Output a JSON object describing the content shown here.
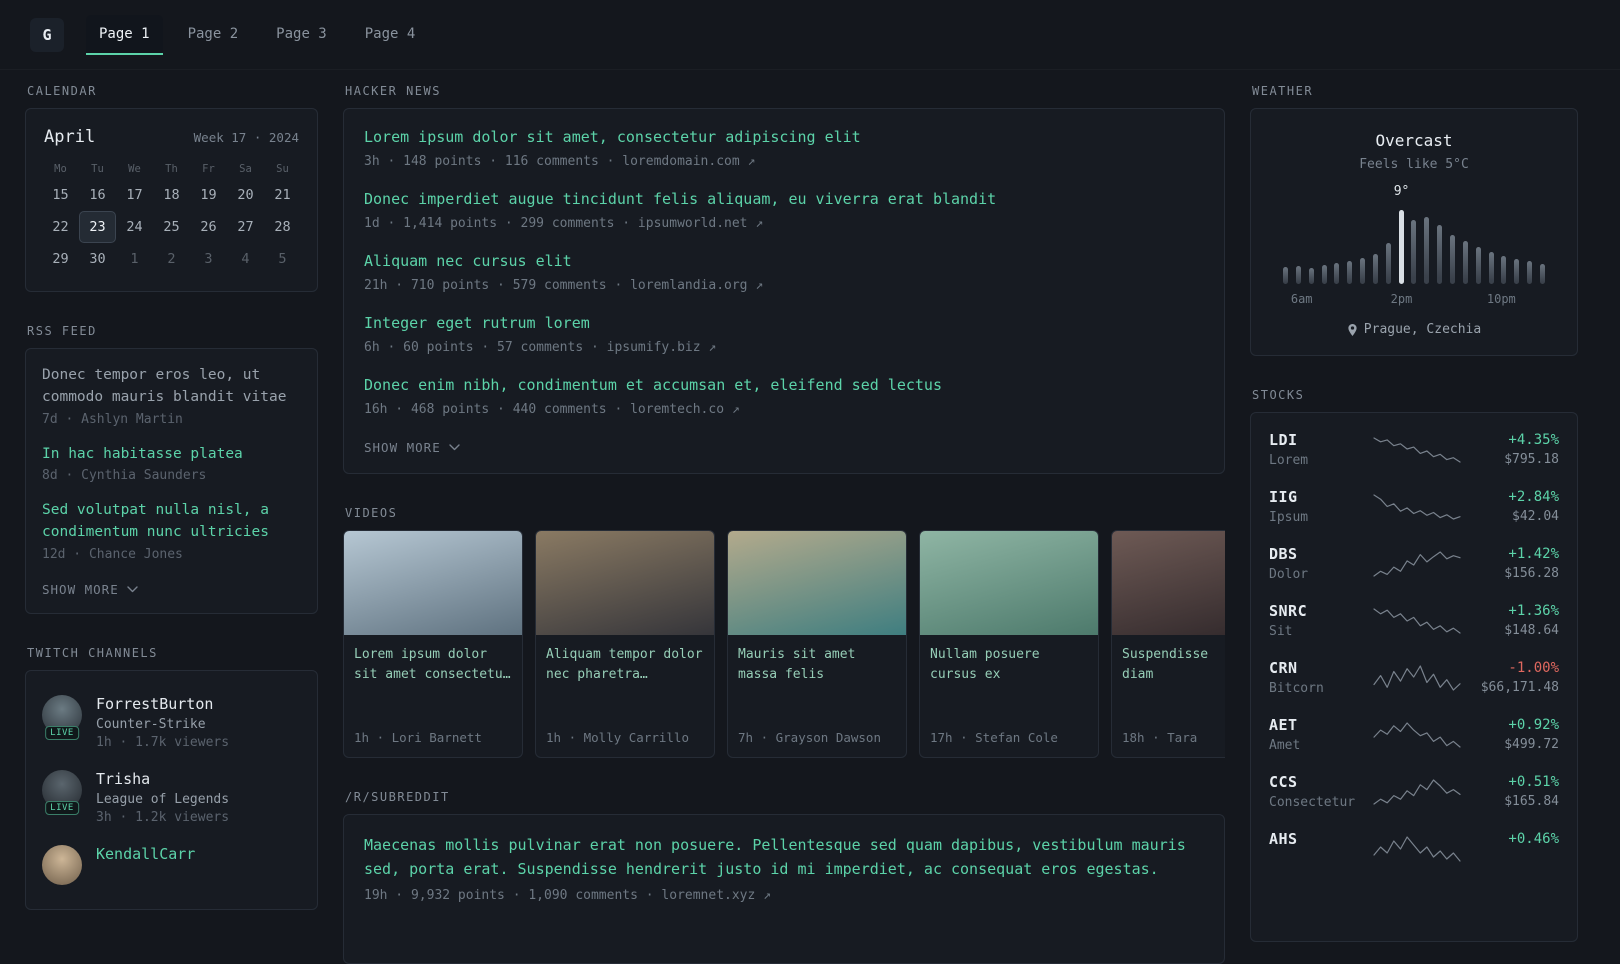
{
  "theme": {
    "accent": "#5cd3a9",
    "negative": "#e0685f",
    "background": "#14171d",
    "card": "#171b22",
    "border": "#262c36",
    "spark_color": "#79828d"
  },
  "header": {
    "logo": "G",
    "tabs": [
      {
        "label": "Page 1",
        "active": true
      },
      {
        "label": "Page 2",
        "active": false
      },
      {
        "label": "Page 3",
        "active": false
      },
      {
        "label": "Page 4",
        "active": false
      }
    ]
  },
  "calendar": {
    "title": "CALENDAR",
    "month": "April",
    "meta": "Week 17 · 2024",
    "day_headers": [
      "Mo",
      "Tu",
      "We",
      "Th",
      "Fr",
      "Sa",
      "Su"
    ],
    "days": [
      {
        "n": "15"
      },
      {
        "n": "16"
      },
      {
        "n": "17"
      },
      {
        "n": "18"
      },
      {
        "n": "19"
      },
      {
        "n": "20"
      },
      {
        "n": "21"
      },
      {
        "n": "22"
      },
      {
        "n": "23",
        "today": true
      },
      {
        "n": "24"
      },
      {
        "n": "25"
      },
      {
        "n": "26"
      },
      {
        "n": "27"
      },
      {
        "n": "28"
      },
      {
        "n": "29"
      },
      {
        "n": "30"
      },
      {
        "n": "1",
        "muted": true
      },
      {
        "n": "2",
        "muted": true
      },
      {
        "n": "3",
        "muted": true
      },
      {
        "n": "4",
        "muted": true
      },
      {
        "n": "5",
        "muted": true
      }
    ]
  },
  "rss": {
    "title": "RSS FEED",
    "items": [
      {
        "title": "Donec tempor eros leo, ut commodo mauris blandit vitae",
        "meta": "7d · Ashlyn Martin",
        "muted": true
      },
      {
        "title": "In hac habitasse platea",
        "meta": "8d · Cynthia Saunders"
      },
      {
        "title": "Sed volutpat nulla nisl, a condimentum nunc ultricies",
        "meta": "12d · Chance Jones"
      }
    ],
    "show_more": "SHOW MORE"
  },
  "twitch": {
    "title": "TWITCH CHANNELS",
    "items": [
      {
        "name": "ForrestBurton",
        "game": "Counter-Strike",
        "meta": "1h · 1.7k viewers",
        "live": "LIVE",
        "avatar": [
          "#6b7b83",
          "#2a3138"
        ]
      },
      {
        "name": "Trisha",
        "game": "League of Legends",
        "meta": "3h · 1.2k viewers",
        "live": "LIVE",
        "avatar": [
          "#5a656d",
          "#23282e"
        ]
      },
      {
        "name": "KendallCarr",
        "game": "",
        "meta": "",
        "live": "",
        "avatar": [
          "#cdb697",
          "#6f5e4a"
        ],
        "accent": true
      }
    ]
  },
  "hackernews": {
    "title": "HACKER NEWS",
    "items": [
      {
        "title": "Lorem ipsum dolor sit amet, consectetur adipiscing elit",
        "meta": "3h · 148 points · 116 comments · loremdomain.com ↗"
      },
      {
        "title": "Donec imperdiet augue tincidunt felis aliquam, eu viverra erat blandit",
        "meta": "1d · 1,414 points · 299 comments · ipsumworld.net ↗"
      },
      {
        "title": "Aliquam nec cursus elit",
        "meta": "21h · 710 points · 579 comments · loremlandia.org ↗"
      },
      {
        "title": "Integer eget rutrum lorem",
        "meta": "6h · 60 points · 57 comments · ipsumify.biz ↗"
      },
      {
        "title": "Donec enim nibh, condimentum et accumsan et, eleifend sed lectus",
        "meta": "16h · 468 points · 440 comments · loremtech.co ↗"
      }
    ],
    "show_more": "SHOW MORE"
  },
  "videos": {
    "title": "VIDEOS",
    "items": [
      {
        "title": "Lorem ipsum dolor\nsit amet consectetu…",
        "meta": "1h · Lori Barnett",
        "thumb": [
          "#b6c7d3",
          "#5f7280"
        ]
      },
      {
        "title": "Aliquam tempor dolor\nnec pharetra…",
        "meta": "1h · Molly Carrillo",
        "thumb": [
          "#8a7a63",
          "#35353a"
        ]
      },
      {
        "title": "Mauris sit amet\nmassa felis",
        "meta": "7h · Grayson Dawson",
        "thumb": [
          "#b3aa8c",
          "#3f7e80"
        ]
      },
      {
        "title": "Nullam posuere\ncursus ex",
        "meta": "17h · Stefan Cole",
        "thumb": [
          "#8fb5a4",
          "#4d7a6c"
        ]
      },
      {
        "title": "Suspendisse\ndiam",
        "meta": "18h · Tara",
        "thumb": [
          "#6e5a55",
          "#2e2629"
        ]
      }
    ]
  },
  "subreddit": {
    "title": "/R/SUBREDDIT",
    "items": [
      {
        "title": "Maecenas mollis pulvinar erat non posuere. Pellentesque sed quam dapibus, vestibulum mauris sed, porta erat. Suspendisse hendrerit justo id mi imperdiet, ac consequat eros egestas.",
        "meta": "19h · 9,932 points · 1,090 comments · loremnet.xyz ↗"
      }
    ]
  },
  "weather": {
    "title": "WEATHER",
    "condition": "Overcast",
    "feels_like": "Feels like 5°C",
    "current_label": "9°",
    "location": "Prague, Czechia",
    "chart_data": {
      "type": "bar",
      "bars": [
        0.22,
        0.23,
        0.21,
        0.25,
        0.27,
        0.29,
        0.33,
        0.39,
        0.52,
        0.95,
        0.82,
        0.86,
        0.76,
        0.63,
        0.55,
        0.47,
        0.41,
        0.36,
        0.32,
        0.29,
        0.26
      ],
      "highlight_index": 9,
      "time_labels": [
        {
          "label": "6am",
          "index": 1
        },
        {
          "label": "2pm",
          "index": 9
        },
        {
          "label": "10pm",
          "index": 17
        }
      ]
    }
  },
  "stocks": {
    "title": "STOCKS",
    "items": [
      {
        "ticker": "LDI",
        "name": "Lorem",
        "change": "+4.35%",
        "price": "$795.18",
        "down": false,
        "spark": [
          8.2,
          7.4,
          7.8,
          6.6,
          7.0,
          5.9,
          6.3,
          5.0,
          5.5,
          4.3,
          4.8,
          3.7,
          4.1,
          3.2
        ]
      },
      {
        "ticker": "IIG",
        "name": "Ipsum",
        "change": "+2.84%",
        "price": "$42.04",
        "down": false,
        "spark": [
          8.8,
          7.9,
          6.3,
          6.9,
          5.3,
          6.0,
          4.8,
          5.4,
          4.4,
          5.0,
          3.9,
          4.5,
          3.6,
          4.1
        ]
      },
      {
        "ticker": "DBS",
        "name": "Dolor",
        "change": "+1.42%",
        "price": "$156.28",
        "down": false,
        "spark": [
          3.4,
          4.3,
          3.7,
          5.1,
          4.3,
          6.3,
          5.5,
          7.5,
          6.1,
          7.1,
          8.0,
          6.7,
          7.3,
          6.9
        ]
      },
      {
        "ticker": "SNRC",
        "name": "Sit",
        "change": "+1.36%",
        "price": "$148.64",
        "down": false,
        "spark": [
          7.9,
          7.1,
          7.7,
          6.5,
          7.1,
          5.9,
          6.5,
          5.1,
          5.7,
          4.5,
          5.1,
          4.1,
          4.7,
          3.9
        ]
      },
      {
        "ticker": "CRN",
        "name": "Bitcorn",
        "change": "-1.00%",
        "price": "$66,171.48",
        "down": true,
        "spark": [
          5.0,
          6.3,
          4.6,
          6.9,
          5.5,
          7.3,
          6.1,
          7.7,
          5.3,
          6.5,
          4.6,
          5.7,
          4.2,
          5.1
        ]
      },
      {
        "ticker": "AET",
        "name": "Amet",
        "change": "+0.92%",
        "price": "$499.72",
        "down": false,
        "spark": [
          5.5,
          6.5,
          5.9,
          7.1,
          6.3,
          7.5,
          6.5,
          5.7,
          6.1,
          4.9,
          5.5,
          4.3,
          4.9,
          4.1
        ]
      },
      {
        "ticker": "CCS",
        "name": "Consectetur",
        "change": "+0.51%",
        "price": "$165.84",
        "down": false,
        "spark": [
          3.7,
          4.5,
          3.9,
          5.1,
          4.5,
          5.9,
          5.1,
          6.9,
          6.1,
          7.7,
          6.7,
          5.5,
          6.1,
          5.3
        ]
      },
      {
        "ticker": "AHS",
        "name": "",
        "change": "+0.46%",
        "price": "",
        "down": false,
        "spark": [
          5.1,
          5.9,
          5.3,
          6.5,
          5.7,
          6.9,
          6.1,
          5.3,
          5.9,
          4.9,
          5.5,
          4.7,
          5.3,
          4.5
        ]
      }
    ]
  }
}
